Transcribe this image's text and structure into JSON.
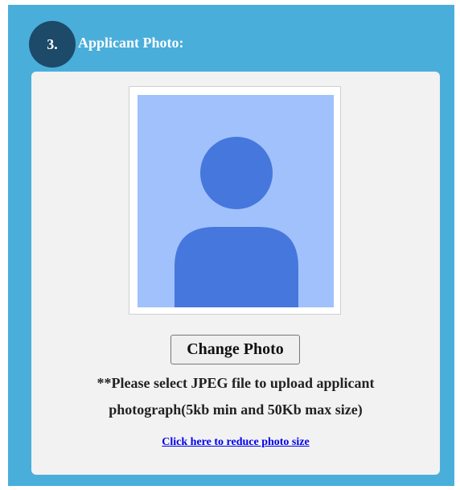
{
  "section": {
    "number": "3.",
    "title": "Applicant Photo:"
  },
  "photo": {
    "icon": "person-silhouette-icon",
    "background_color": "#a0c1fb",
    "silhouette_color": "#4677dd"
  },
  "change_button": {
    "label": "Change Photo"
  },
  "note": {
    "line1": "**Please select JPEG file to upload applicant",
    "line2": "photograph(5kb min and 50Kb max size)"
  },
  "reduce_link": {
    "label": "Click here to reduce photo size"
  },
  "colors": {
    "panel": "#4aaedb",
    "badge": "#1c4a68",
    "card": "#f2f2f2",
    "link": "#0000ee"
  }
}
